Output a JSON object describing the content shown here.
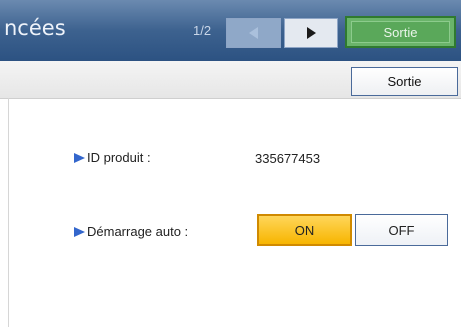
{
  "header": {
    "title": "ncées",
    "page_indicator": "1/2",
    "prev_icon": "triangle-left",
    "next_icon": "triangle-right",
    "exit_label": "Sortie"
  },
  "subheader": {
    "exit_label": "Sortie"
  },
  "settings": {
    "product_id": {
      "label": "ID produit :",
      "value": "335677453"
    },
    "auto_start": {
      "label": "Démarrage auto :",
      "on_label": "ON",
      "off_label": "OFF",
      "selected": "ON"
    }
  },
  "colors": {
    "header_bg": "#3d628f",
    "selected_toggle": "#f7b500",
    "exit_green": "#5aa85a",
    "bullet": "#3366cc"
  }
}
